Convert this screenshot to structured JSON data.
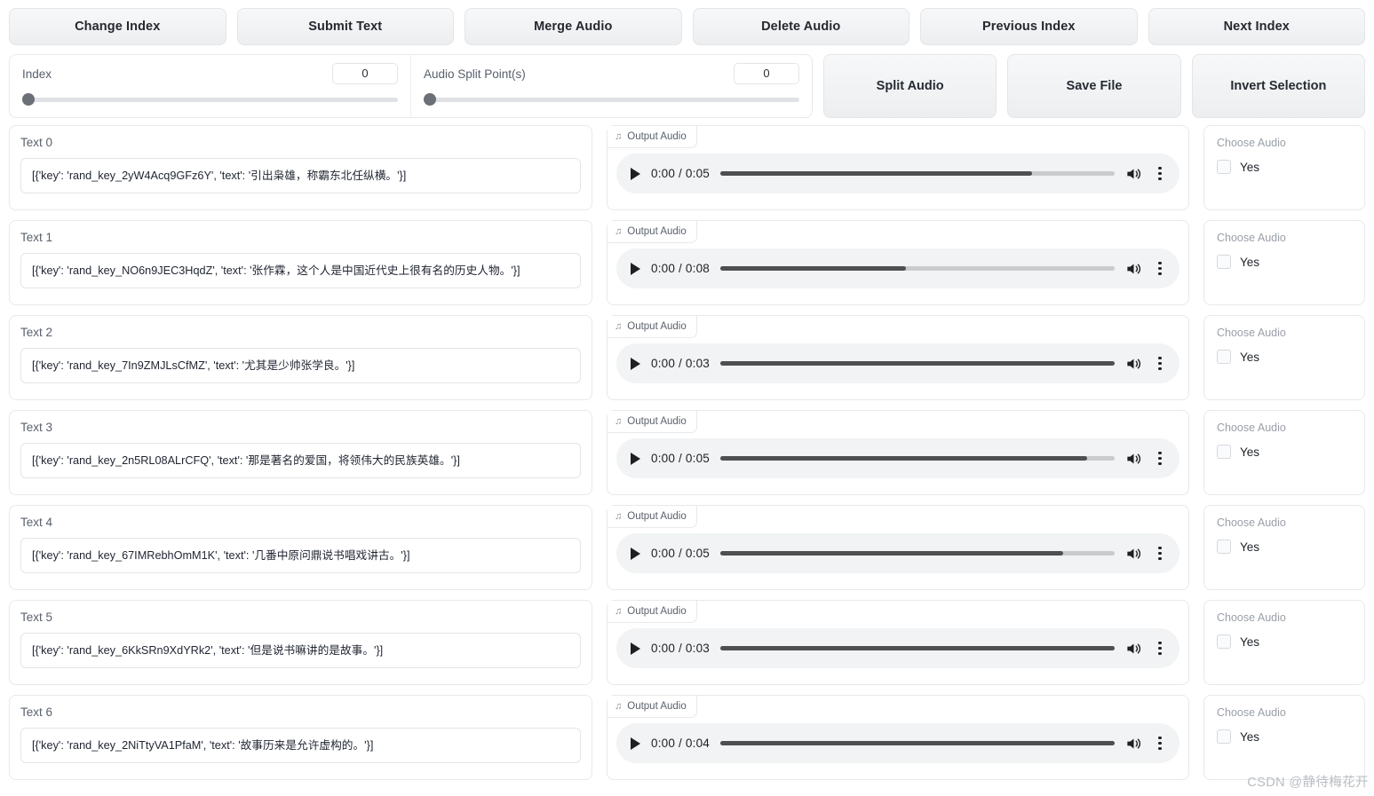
{
  "toolbar": {
    "buttons": [
      {
        "label": "Change Index",
        "name": "change-index-button"
      },
      {
        "label": "Submit Text",
        "name": "submit-text-button"
      },
      {
        "label": "Merge Audio",
        "name": "merge-audio-button"
      },
      {
        "label": "Delete Audio",
        "name": "delete-audio-button"
      },
      {
        "label": "Previous Index",
        "name": "previous-index-button"
      },
      {
        "label": "Next Index",
        "name": "next-index-button"
      }
    ]
  },
  "sliders": [
    {
      "label": "Index",
      "value": "0",
      "knob_percent": 0
    },
    {
      "label": "Audio Split Point(s)",
      "value": "0",
      "knob_percent": 0
    }
  ],
  "action_buttons": [
    {
      "label": "Split Audio",
      "name": "split-audio-button"
    },
    {
      "label": "Save File",
      "name": "save-file-button"
    },
    {
      "label": "Invert Selection",
      "name": "invert-selection-button"
    }
  ],
  "audio_tag_label": "Output Audio",
  "choose_audio_label": "Choose Audio",
  "choose_audio_option": "Yes",
  "rows": [
    {
      "text_label": "Text 0",
      "text_value": "[{'key': 'rand_key_2yW4Acq9GFz6Y', 'text': '引出枭雄，称霸东北任纵横。'}]",
      "time": "0:00 / 0:05",
      "progress_percent": 79,
      "checked": false
    },
    {
      "text_label": "Text 1",
      "text_value": "[{'key': 'rand_key_NO6n9JEC3HqdZ', 'text': '张作霖，这个人是中国近代史上很有名的历史人物。'}]",
      "time": "0:00 / 0:08",
      "progress_percent": 47,
      "checked": false
    },
    {
      "text_label": "Text 2",
      "text_value": "[{'key': 'rand_key_7In9ZMJLsCfMZ', 'text': '尤其是少帅张学良。'}]",
      "time": "0:00 / 0:03",
      "progress_percent": 100,
      "checked": false
    },
    {
      "text_label": "Text 3",
      "text_value": "[{'key': 'rand_key_2n5RL08ALrCFQ', 'text': '那是著名的爱国，将领伟大的民族英雄。'}]",
      "time": "0:00 / 0:05",
      "progress_percent": 93,
      "checked": false
    },
    {
      "text_label": "Text 4",
      "text_value": "[{'key': 'rand_key_67IMRebhOmM1K', 'text': '几番中原问鼎说书唱戏讲古。'}]",
      "time": "0:00 / 0:05",
      "progress_percent": 87,
      "checked": false
    },
    {
      "text_label": "Text 5",
      "text_value": "[{'key': 'rand_key_6KkSRn9XdYRk2', 'text': '但是说书嘛讲的是故事。'}]",
      "time": "0:00 / 0:03",
      "progress_percent": 100,
      "checked": false
    },
    {
      "text_label": "Text 6",
      "text_value": "[{'key': 'rand_key_2NiTtyVA1PfaM', 'text': '故事历来是允许虚构的。'}]",
      "time": "0:00 / 0:04",
      "progress_percent": 100,
      "checked": false
    }
  ],
  "watermark": "CSDN @静待梅花开"
}
